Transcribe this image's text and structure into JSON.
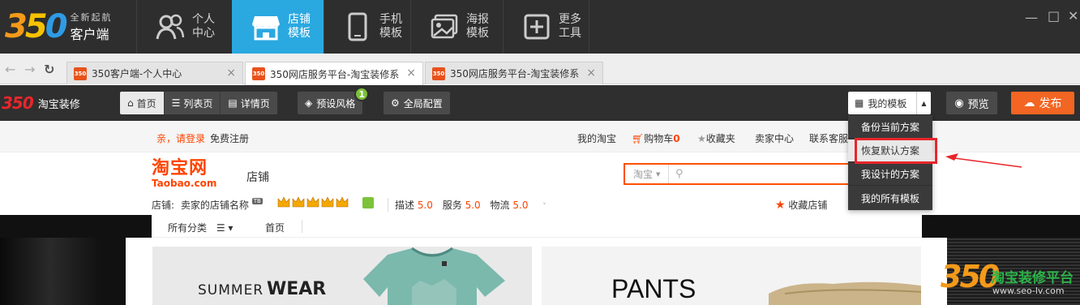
{
  "app": {
    "logo_number": "350",
    "logo_tagline": "全新起航",
    "logo_name": "客户端",
    "nav": [
      {
        "label": "个人中心",
        "icon": "user-icon"
      },
      {
        "label": "店铺模板",
        "icon": "store-icon"
      },
      {
        "label": "手机模板",
        "icon": "phone-icon"
      },
      {
        "label": "海报模板",
        "icon": "poster-icon"
      },
      {
        "label": "更多工具",
        "icon": "plus-icon"
      }
    ],
    "window_controls": [
      "minimize-icon",
      "maximize-icon",
      "close-icon"
    ]
  },
  "browser": {
    "tabs": [
      {
        "favicon": "350",
        "title": "350客户端-个人中心"
      },
      {
        "favicon": "350",
        "title": "350网店服务平台-淘宝装修系"
      },
      {
        "favicon": "350",
        "title": "350网店服务平台-淘宝装修系"
      }
    ],
    "close_glyph": "×"
  },
  "editor": {
    "logo_number": "350",
    "logo_label": "淘宝装修",
    "page_tabs": [
      "首页",
      "列表页",
      "详情页"
    ],
    "preset_style": "预设风格",
    "preset_badge": "1",
    "global_config": "全局配置",
    "my_templates": "我的模板",
    "preview": "预览",
    "publish": "发布",
    "dropdown": [
      "备份当前方案",
      "恢复默认方案",
      "我设计的方案",
      "我的所有模板"
    ]
  },
  "taobao": {
    "greeting": "亲，请登录",
    "register": "免费注册",
    "my_taobao": "我的淘宝",
    "cart": "购物车",
    "cart_count": "0",
    "favorites": "收藏夹",
    "seller_center": "卖家中心",
    "contact": "联系客服",
    "logo_cn": "淘宝网",
    "logo_en": "Taobao.com",
    "store_word": "店铺",
    "search_scope": "淘宝",
    "store_label": "店铺:",
    "store_name": "卖家的店铺名称",
    "store_tag": "TB",
    "ratings": [
      {
        "label": "描述",
        "value": "5.0"
      },
      {
        "label": "服务",
        "value": "5.0"
      },
      {
        "label": "物流",
        "value": "5.0"
      }
    ],
    "favorite_store": "收藏店铺",
    "all_categories": "所有分类",
    "home": "首页",
    "banner1_text_a": "SUMMER",
    "banner1_text_b": "WEAR",
    "banner2_text": "PANTS"
  },
  "watermark": {
    "number": "350",
    "title": "淘宝装修平台",
    "url": "www.seo-lv.com"
  },
  "colors": {
    "accent_blue": "#2aa8e0",
    "publish_orange": "#f26522",
    "taobao_orange": "#ff4400",
    "highlight_red": "#e8262b"
  }
}
